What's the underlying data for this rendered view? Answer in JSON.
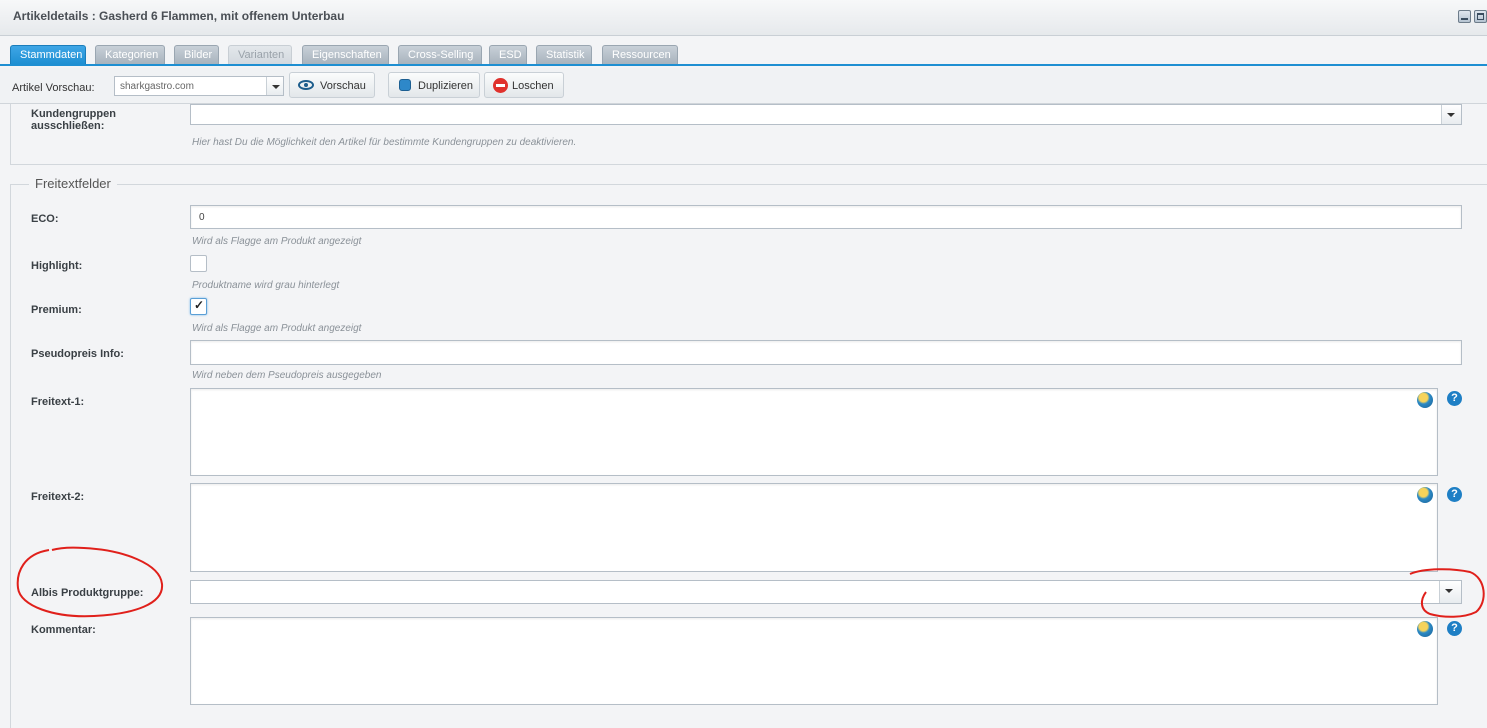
{
  "window": {
    "title": "Artikeldetails : Gasherd 6 Flammen, mit offenem Unterbau"
  },
  "tabs": [
    {
      "label": "Stammdaten",
      "state": "active"
    },
    {
      "label": "Kategorien",
      "state": "normal"
    },
    {
      "label": "Bilder",
      "state": "normal"
    },
    {
      "label": "Varianten",
      "state": "disabled"
    },
    {
      "label": "Eigenschaften",
      "state": "normal"
    },
    {
      "label": "Cross-Selling",
      "state": "normal"
    },
    {
      "label": "ESD",
      "state": "normal"
    },
    {
      "label": "Statistik",
      "state": "normal"
    },
    {
      "label": "Ressourcen",
      "state": "normal"
    }
  ],
  "toolbar": {
    "preview_label": "Artikel Vorschau:",
    "shop_value": "sharkgastro.com",
    "preview_button": "Vorschau",
    "duplicate_button": "Duplizieren",
    "delete_button": "Loschen"
  },
  "customer_groups": {
    "label": "Kundengruppen ausschließen:",
    "help": "Hier hast Du die Möglichkeit den Artikel für bestimmte Kundengruppen zu deaktivieren."
  },
  "freitext": {
    "legend": "Freitextfelder",
    "eco": {
      "label": "ECO:",
      "value": "0",
      "help": "Wird als Flagge am Produkt angezeigt"
    },
    "highlight": {
      "label": "Highlight:",
      "checked": false,
      "help": "Produktname wird grau hinterlegt"
    },
    "premium": {
      "label": "Premium:",
      "checked": true,
      "help": "Wird als Flagge am Produkt angezeigt"
    },
    "pseudopreis": {
      "label": "Pseudopreis Info:",
      "value": "",
      "help": "Wird neben dem Pseudopreis ausgegeben"
    },
    "freitext1": {
      "label": "Freitext-1:",
      "value": ""
    },
    "freitext2": {
      "label": "Freitext-2:",
      "value": ""
    },
    "albis": {
      "label": "Albis Produktgruppe:",
      "value": ""
    },
    "kommentar": {
      "label": "Kommentar:",
      "value": ""
    }
  },
  "icons": {
    "translate": "globe-icon",
    "help": "help-icon",
    "check": "✓",
    "question": "?"
  },
  "colors": {
    "accent": "#1e8fd2",
    "annotation": "#e0201b",
    "delete": "#e0312c"
  }
}
